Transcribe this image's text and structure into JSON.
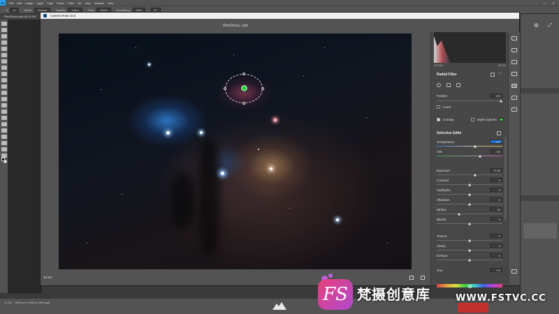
{
  "photoshop": {
    "menu": [
      "File",
      "Edit",
      "Image",
      "Layer",
      "Type",
      "Select",
      "Filter",
      "3D",
      "View",
      "Window",
      "Help"
    ],
    "options": {
      "mode_label": "Mode:",
      "mode_value": "Normal",
      "opacity_label": "Opacity:",
      "opacity_value": "100%",
      "flow_label": "Flow:",
      "flow_value": "100%",
      "smoothing_label": "Smoothing:",
      "smoothing_value": "10%",
      "angle_value": "0°"
    },
    "doc_tab": "RhoOfuscu.psb @ 41.3%",
    "status": "41.3%",
    "status_doc": "6000 px x 4000 px (300 ppi)"
  },
  "camera_raw": {
    "window_title": "Camera Raw 15.5",
    "filename": "RhoOfuscu .psb",
    "zoom": "40.5%",
    "histogram": {
      "iso": "ISO 800",
      "shutter": "80.00s"
    },
    "radial_filter": {
      "title": "Radial Filter",
      "feather_label": "Feather",
      "feather_value": "100",
      "invert_label": "Invert",
      "overlay_label": "Overlay",
      "mask_options_label": "Mask Options",
      "overlay_checked": true,
      "invert_checked": false,
      "overlay_color": "#40c040"
    },
    "selective_edits": {
      "title": "Selective Edits",
      "rows": [
        {
          "label": "Temperature",
          "value": "+17",
          "pos": 0.58
        },
        {
          "label": "Tint",
          "value": "+39",
          "pos": 0.66
        },
        {
          "label": "Exposure",
          "value": "+0.95",
          "pos": 0.59
        },
        {
          "label": "Contrast",
          "value": "0",
          "pos": 0.5
        },
        {
          "label": "Highlights",
          "value": "0",
          "pos": 0.5
        },
        {
          "label": "Shadows",
          "value": "0",
          "pos": 0.5
        },
        {
          "label": "Whites",
          "value": "-32",
          "pos": 0.34
        },
        {
          "label": "Blacks",
          "value": "0",
          "pos": 0.5
        },
        {
          "label": "Texture",
          "value": "0",
          "pos": 0.5
        },
        {
          "label": "Clarity",
          "value": "0",
          "pos": 0.5
        },
        {
          "label": "Dehaze",
          "value": "0",
          "pos": 0.5
        },
        {
          "label": "Hue",
          "value": "0.0",
          "pos": 0.5
        }
      ]
    }
  },
  "watermark": {
    "badge_text": "FS",
    "cn_text": "梵摄创意库",
    "url": "WWW.FSTVC.CC"
  }
}
